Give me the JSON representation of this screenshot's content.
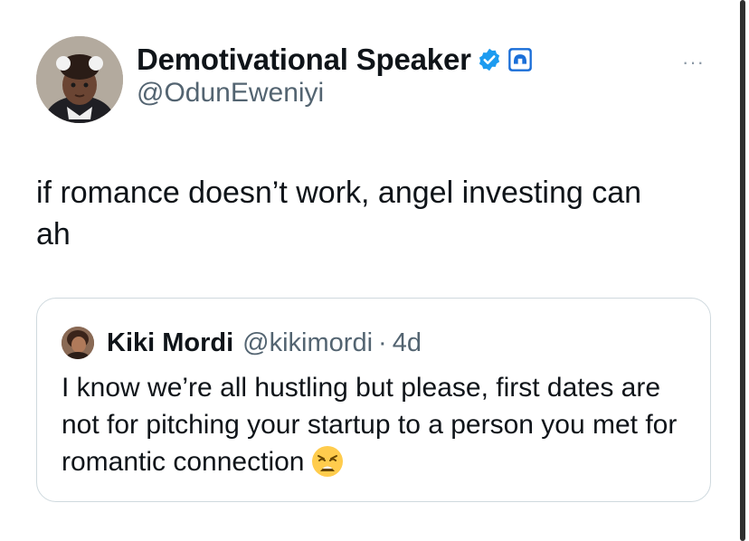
{
  "tweet": {
    "author": {
      "display_name": "Demotivational Speaker",
      "handle": "@OdunEweniyi",
      "avatar_icon": "avatar-photo",
      "verified_icon": "verified-badge-icon",
      "affiliate_icon": "affiliate-badge-icon"
    },
    "more_label": "···",
    "text": "if romance doesn’t work, angel investing can\nah"
  },
  "quote": {
    "display_name": "Kiki Mordi",
    "handle": "@kikimordi",
    "separator": "·",
    "time": "4d",
    "text": "I know we’re all hustling but please, first dates are not for pitching your startup to a person you met for romantic connection",
    "emoji_icon": "weary-face-emoji"
  },
  "colors": {
    "verified_blue": "#1d9bf0",
    "affiliate_blue": "#1a6ed8",
    "secondary_text": "#536471",
    "border": "#cfd9de"
  }
}
